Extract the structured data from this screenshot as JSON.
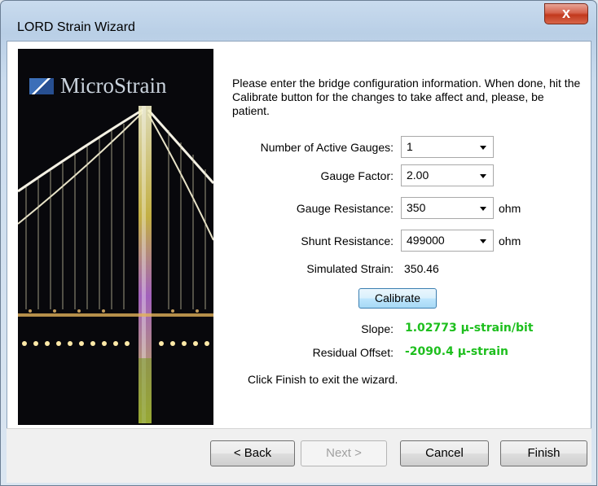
{
  "window": {
    "title": "LORD Strain Wizard",
    "close_glyph": "x"
  },
  "image_panel": {
    "logo_text": "MicroStrain",
    "logo_icon": "microstrain-logo-icon"
  },
  "intro_text": "Please enter the bridge configuration information.  When done, hit the Calibrate button for the changes to take affect and, please, be patient.",
  "form": {
    "active_gauges": {
      "label": "Number of Active Gauges:",
      "value": "1"
    },
    "gauge_factor": {
      "label": "Gauge Factor:",
      "value": "2.00"
    },
    "gauge_resistance": {
      "label": "Gauge Resistance:",
      "value": "350",
      "unit": "ohm"
    },
    "shunt_resistance": {
      "label": "Shunt Resistance:",
      "value": "499000",
      "unit": "ohm"
    },
    "simulated_strain": {
      "label": "Simulated Strain:",
      "value": "350.46"
    }
  },
  "calibrate_label": "Calibrate",
  "results": {
    "slope": {
      "label": "Slope:",
      "value": "1.02773 µ-strain/bit"
    },
    "residual_offset": {
      "label": "Residual Offset:",
      "value": "-2090.4 µ-strain"
    }
  },
  "finish_hint": "Click Finish to exit the wizard.",
  "buttons": {
    "back": "< Back",
    "next": "Next >",
    "cancel": "Cancel",
    "finish": "Finish"
  },
  "colors": {
    "result_green": "#1ebf1e",
    "close_red": "#c2391d"
  }
}
